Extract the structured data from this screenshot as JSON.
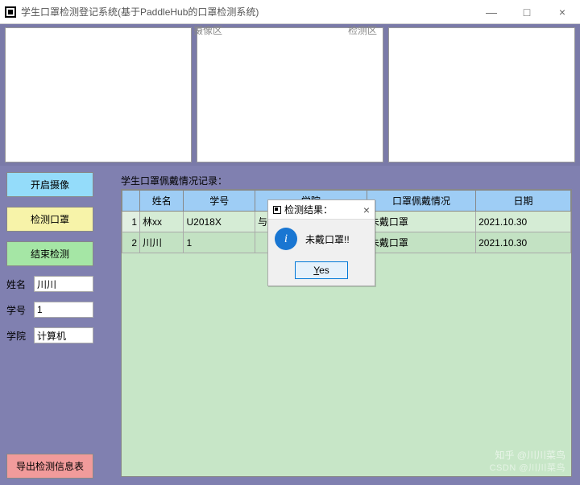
{
  "window": {
    "title": "学生口罩检测登记系统(基于PaddleHub的口罩检测系统)",
    "min": "—",
    "max": "□",
    "close": "×"
  },
  "camera": {
    "label1": "摄像区",
    "label2": "检测区"
  },
  "sidebar": {
    "btn_start": "开启摄像",
    "btn_detect": "检测口罩",
    "btn_end": "结束检测",
    "btn_export": "导出检测信息表",
    "name_label": "姓名",
    "name_value": "川川",
    "id_label": "学号",
    "id_value": "1",
    "college_label": "学院",
    "college_value": "计算机"
  },
  "records": {
    "title": "学生口罩佩戴情况记录：",
    "headers": [
      "姓名",
      "学号",
      "学院",
      "口罩佩戴情况",
      "日期"
    ],
    "rows": [
      {
        "n": "1",
        "name": "林xx",
        "id": "U2018X",
        "college": "与自动化学院",
        "mask": "未戴口罩",
        "date": "2021.10.30"
      },
      {
        "n": "2",
        "name": "川川",
        "id": "1",
        "college": "",
        "mask": "未戴口罩",
        "date": "2021.10.30"
      }
    ]
  },
  "dialog": {
    "title": "检测结果：",
    "message": "未戴口罩!!",
    "yes": "Yes",
    "close": "×"
  },
  "watermark": {
    "line1": "知乎 @川川菜鸟",
    "line2": "CSDN @川川菜鸟"
  }
}
